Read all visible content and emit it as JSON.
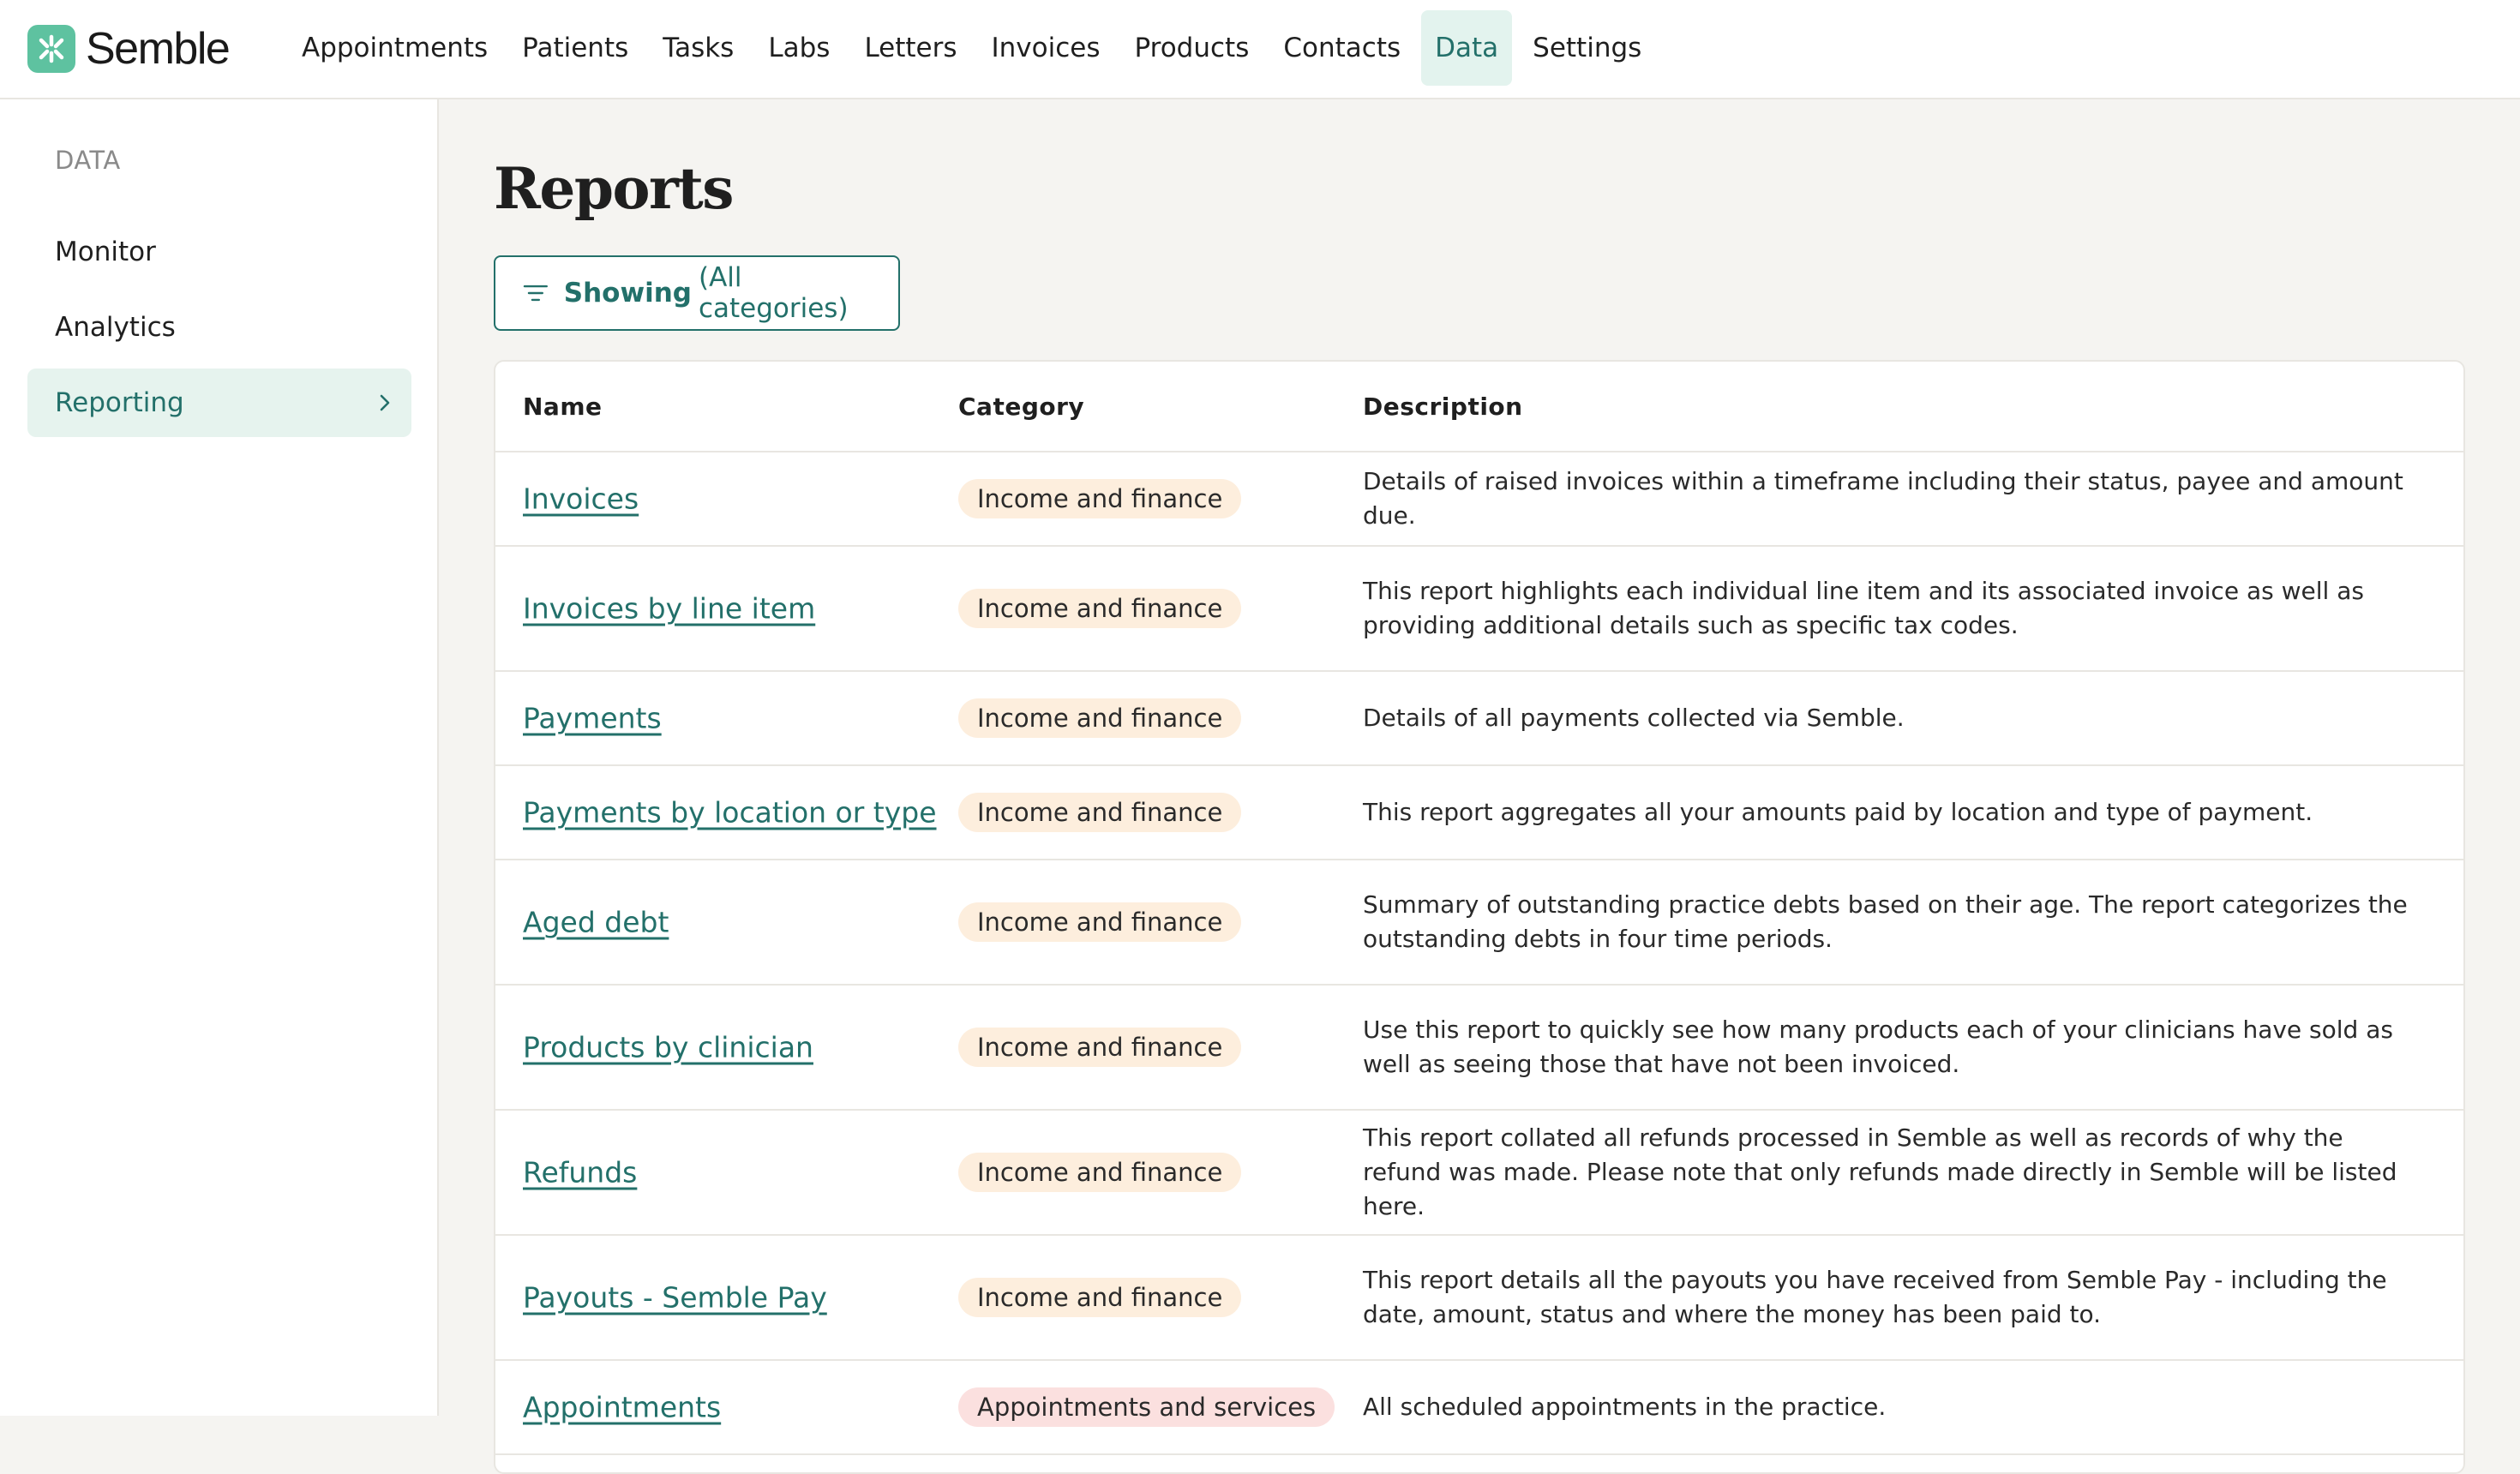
{
  "app": {
    "name": "Semble"
  },
  "nav": {
    "items": [
      {
        "label": "Appointments"
      },
      {
        "label": "Patients"
      },
      {
        "label": "Tasks"
      },
      {
        "label": "Labs"
      },
      {
        "label": "Letters"
      },
      {
        "label": "Invoices"
      },
      {
        "label": "Products"
      },
      {
        "label": "Contacts"
      },
      {
        "label": "Data",
        "active": true
      },
      {
        "label": "Settings"
      }
    ]
  },
  "sidebar": {
    "heading": "DATA",
    "items": [
      {
        "label": "Monitor"
      },
      {
        "label": "Analytics"
      },
      {
        "label": "Reporting",
        "active": true
      }
    ]
  },
  "page": {
    "title": "Reports"
  },
  "filter": {
    "label_strong": "Showing",
    "label_rest": "(All categories)"
  },
  "table": {
    "headers": {
      "name": "Name",
      "category": "Category",
      "description": "Description"
    },
    "rows": [
      {
        "name": "Invoices",
        "category": "Income and finance",
        "description": "Details of raised invoices within a timeframe including their status, payee and amount due."
      },
      {
        "name": "Invoices by line item",
        "category": "Income and finance",
        "description": "This report highlights each individual line item and its associated invoice as well as providing additional details such as specific tax codes."
      },
      {
        "name": "Payments",
        "category": "Income and finance",
        "description": "Details of all payments collected via Semble."
      },
      {
        "name": "Payments by location or type",
        "category": "Income and finance",
        "description": "This report aggregates all your amounts paid by location and type of payment."
      },
      {
        "name": "Aged debt",
        "category": "Income and finance",
        "description": "Summary of outstanding practice debts based on their age. The report categorizes the outstanding debts in four time periods."
      },
      {
        "name": "Products by clinician",
        "category": "Income and finance",
        "description": "Use this report to quickly see how many products each of your clinicians have sold as well as seeing those that have not been invoiced."
      },
      {
        "name": "Refunds",
        "category": "Income and finance",
        "description": "This report collated all refunds processed in Semble as well as records of why the refund was made. Please note that only refunds made directly in Semble will be listed here."
      },
      {
        "name": "Payouts - Semble Pay",
        "category": "Income and finance",
        "description": "This report details all the payouts you have received from Semble Pay - including the date, amount, status and where the money has been paid to."
      },
      {
        "name": "Appointments",
        "category": "Appointments and services",
        "description": "All scheduled appointments in the practice."
      }
    ]
  },
  "colors": {
    "accent": "#23706a",
    "logo": "#5ec2a0",
    "active_bg": "#e3f3ee",
    "finance_badge": "#fdeedd",
    "appointments_badge": "#fbe0df"
  },
  "icons": {
    "logo": "semble-logo-icon",
    "filter": "filter-lines-icon",
    "chevron": "chevron-right-icon"
  }
}
